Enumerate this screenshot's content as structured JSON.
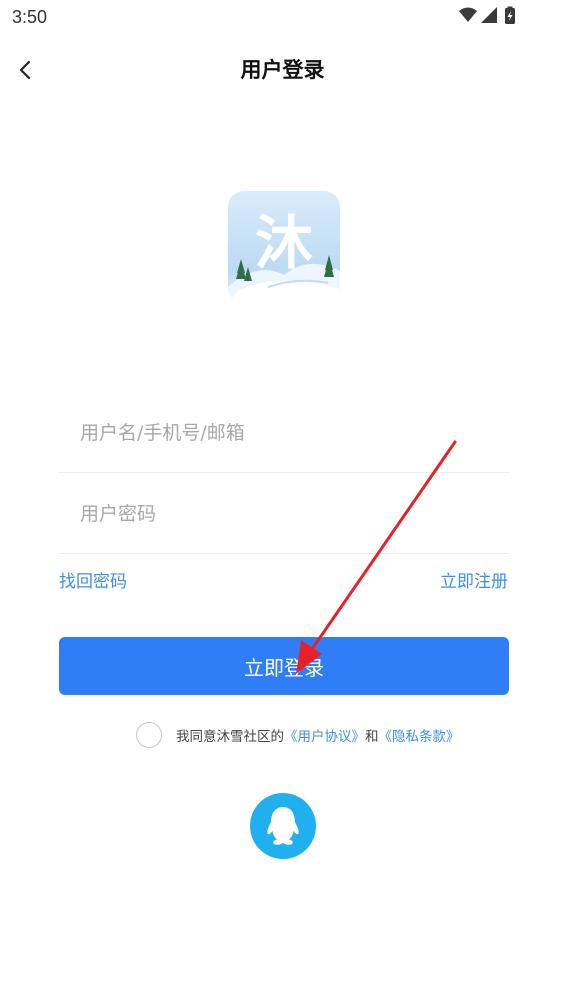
{
  "status_bar": {
    "time": "3:50"
  },
  "nav": {
    "title": "用户登录"
  },
  "logo": {
    "char": "沐"
  },
  "form": {
    "username_placeholder": "用户名/手机号/邮箱",
    "password_placeholder": "用户密码"
  },
  "links": {
    "forgot": "找回密码",
    "register": "立即注册"
  },
  "login_button": "立即登录",
  "agreement": {
    "prefix": "我同意沐雪社区的",
    "user_agreement": "《用户协议》",
    "and": "和",
    "privacy": "《隐私条款》"
  },
  "colors": {
    "primary": "#2f7ef5",
    "link": "#3d8ef4",
    "qq": "#20b0f0",
    "arrow": "#e8202a"
  }
}
